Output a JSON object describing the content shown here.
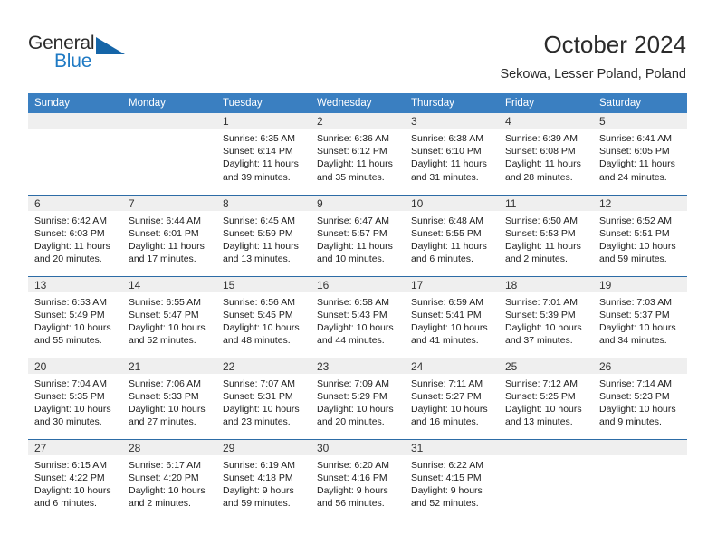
{
  "brand": {
    "name_part1": "General",
    "name_part2": "Blue",
    "triangle_color": "#1565a8",
    "blue_color": "#1f7ac4"
  },
  "header": {
    "title": "October 2024",
    "subtitle": "Sekowa, Lesser Poland, Poland"
  },
  "theme": {
    "header_bg": "#3a7fc1",
    "row_divider": "#2d6ca6",
    "daynum_bg": "#efefef"
  },
  "weekday_headers": [
    "Sunday",
    "Monday",
    "Tuesday",
    "Wednesday",
    "Thursday",
    "Friday",
    "Saturday"
  ],
  "weeks": [
    [
      {
        "day": "",
        "lines": []
      },
      {
        "day": "",
        "lines": []
      },
      {
        "day": "1",
        "lines": [
          "Sunrise: 6:35 AM",
          "Sunset: 6:14 PM",
          "Daylight: 11 hours",
          "and 39 minutes."
        ]
      },
      {
        "day": "2",
        "lines": [
          "Sunrise: 6:36 AM",
          "Sunset: 6:12 PM",
          "Daylight: 11 hours",
          "and 35 minutes."
        ]
      },
      {
        "day": "3",
        "lines": [
          "Sunrise: 6:38 AM",
          "Sunset: 6:10 PM",
          "Daylight: 11 hours",
          "and 31 minutes."
        ]
      },
      {
        "day": "4",
        "lines": [
          "Sunrise: 6:39 AM",
          "Sunset: 6:08 PM",
          "Daylight: 11 hours",
          "and 28 minutes."
        ]
      },
      {
        "day": "5",
        "lines": [
          "Sunrise: 6:41 AM",
          "Sunset: 6:05 PM",
          "Daylight: 11 hours",
          "and 24 minutes."
        ]
      }
    ],
    [
      {
        "day": "6",
        "lines": [
          "Sunrise: 6:42 AM",
          "Sunset: 6:03 PM",
          "Daylight: 11 hours",
          "and 20 minutes."
        ]
      },
      {
        "day": "7",
        "lines": [
          "Sunrise: 6:44 AM",
          "Sunset: 6:01 PM",
          "Daylight: 11 hours",
          "and 17 minutes."
        ]
      },
      {
        "day": "8",
        "lines": [
          "Sunrise: 6:45 AM",
          "Sunset: 5:59 PM",
          "Daylight: 11 hours",
          "and 13 minutes."
        ]
      },
      {
        "day": "9",
        "lines": [
          "Sunrise: 6:47 AM",
          "Sunset: 5:57 PM",
          "Daylight: 11 hours",
          "and 10 minutes."
        ]
      },
      {
        "day": "10",
        "lines": [
          "Sunrise: 6:48 AM",
          "Sunset: 5:55 PM",
          "Daylight: 11 hours",
          "and 6 minutes."
        ]
      },
      {
        "day": "11",
        "lines": [
          "Sunrise: 6:50 AM",
          "Sunset: 5:53 PM",
          "Daylight: 11 hours",
          "and 2 minutes."
        ]
      },
      {
        "day": "12",
        "lines": [
          "Sunrise: 6:52 AM",
          "Sunset: 5:51 PM",
          "Daylight: 10 hours",
          "and 59 minutes."
        ]
      }
    ],
    [
      {
        "day": "13",
        "lines": [
          "Sunrise: 6:53 AM",
          "Sunset: 5:49 PM",
          "Daylight: 10 hours",
          "and 55 minutes."
        ]
      },
      {
        "day": "14",
        "lines": [
          "Sunrise: 6:55 AM",
          "Sunset: 5:47 PM",
          "Daylight: 10 hours",
          "and 52 minutes."
        ]
      },
      {
        "day": "15",
        "lines": [
          "Sunrise: 6:56 AM",
          "Sunset: 5:45 PM",
          "Daylight: 10 hours",
          "and 48 minutes."
        ]
      },
      {
        "day": "16",
        "lines": [
          "Sunrise: 6:58 AM",
          "Sunset: 5:43 PM",
          "Daylight: 10 hours",
          "and 44 minutes."
        ]
      },
      {
        "day": "17",
        "lines": [
          "Sunrise: 6:59 AM",
          "Sunset: 5:41 PM",
          "Daylight: 10 hours",
          "and 41 minutes."
        ]
      },
      {
        "day": "18",
        "lines": [
          "Sunrise: 7:01 AM",
          "Sunset: 5:39 PM",
          "Daylight: 10 hours",
          "and 37 minutes."
        ]
      },
      {
        "day": "19",
        "lines": [
          "Sunrise: 7:03 AM",
          "Sunset: 5:37 PM",
          "Daylight: 10 hours",
          "and 34 minutes."
        ]
      }
    ],
    [
      {
        "day": "20",
        "lines": [
          "Sunrise: 7:04 AM",
          "Sunset: 5:35 PM",
          "Daylight: 10 hours",
          "and 30 minutes."
        ]
      },
      {
        "day": "21",
        "lines": [
          "Sunrise: 7:06 AM",
          "Sunset: 5:33 PM",
          "Daylight: 10 hours",
          "and 27 minutes."
        ]
      },
      {
        "day": "22",
        "lines": [
          "Sunrise: 7:07 AM",
          "Sunset: 5:31 PM",
          "Daylight: 10 hours",
          "and 23 minutes."
        ]
      },
      {
        "day": "23",
        "lines": [
          "Sunrise: 7:09 AM",
          "Sunset: 5:29 PM",
          "Daylight: 10 hours",
          "and 20 minutes."
        ]
      },
      {
        "day": "24",
        "lines": [
          "Sunrise: 7:11 AM",
          "Sunset: 5:27 PM",
          "Daylight: 10 hours",
          "and 16 minutes."
        ]
      },
      {
        "day": "25",
        "lines": [
          "Sunrise: 7:12 AM",
          "Sunset: 5:25 PM",
          "Daylight: 10 hours",
          "and 13 minutes."
        ]
      },
      {
        "day": "26",
        "lines": [
          "Sunrise: 7:14 AM",
          "Sunset: 5:23 PM",
          "Daylight: 10 hours",
          "and 9 minutes."
        ]
      }
    ],
    [
      {
        "day": "27",
        "lines": [
          "Sunrise: 6:15 AM",
          "Sunset: 4:22 PM",
          "Daylight: 10 hours",
          "and 6 minutes."
        ]
      },
      {
        "day": "28",
        "lines": [
          "Sunrise: 6:17 AM",
          "Sunset: 4:20 PM",
          "Daylight: 10 hours",
          "and 2 minutes."
        ]
      },
      {
        "day": "29",
        "lines": [
          "Sunrise: 6:19 AM",
          "Sunset: 4:18 PM",
          "Daylight: 9 hours",
          "and 59 minutes."
        ]
      },
      {
        "day": "30",
        "lines": [
          "Sunrise: 6:20 AM",
          "Sunset: 4:16 PM",
          "Daylight: 9 hours",
          "and 56 minutes."
        ]
      },
      {
        "day": "31",
        "lines": [
          "Sunrise: 6:22 AM",
          "Sunset: 4:15 PM",
          "Daylight: 9 hours",
          "and 52 minutes."
        ]
      },
      {
        "day": "",
        "lines": []
      },
      {
        "day": "",
        "lines": []
      }
    ]
  ]
}
